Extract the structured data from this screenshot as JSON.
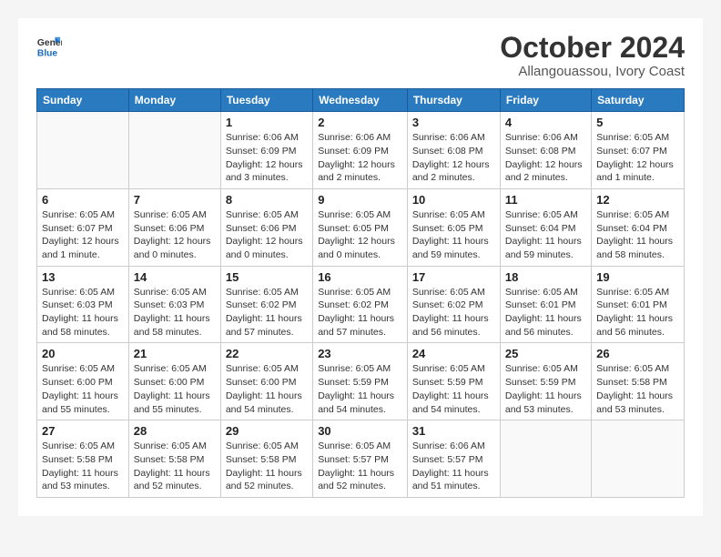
{
  "header": {
    "logo": {
      "line1": "General",
      "line2": "Blue"
    },
    "title": "October 2024",
    "location": "Allangouassou, Ivory Coast"
  },
  "weekdays": [
    "Sunday",
    "Monday",
    "Tuesday",
    "Wednesday",
    "Thursday",
    "Friday",
    "Saturday"
  ],
  "weeks": [
    [
      {
        "day": "",
        "detail": ""
      },
      {
        "day": "",
        "detail": ""
      },
      {
        "day": "1",
        "detail": "Sunrise: 6:06 AM\nSunset: 6:09 PM\nDaylight: 12 hours\nand 3 minutes."
      },
      {
        "day": "2",
        "detail": "Sunrise: 6:06 AM\nSunset: 6:09 PM\nDaylight: 12 hours\nand 2 minutes."
      },
      {
        "day": "3",
        "detail": "Sunrise: 6:06 AM\nSunset: 6:08 PM\nDaylight: 12 hours\nand 2 minutes."
      },
      {
        "day": "4",
        "detail": "Sunrise: 6:06 AM\nSunset: 6:08 PM\nDaylight: 12 hours\nand 2 minutes."
      },
      {
        "day": "5",
        "detail": "Sunrise: 6:05 AM\nSunset: 6:07 PM\nDaylight: 12 hours\nand 1 minute."
      }
    ],
    [
      {
        "day": "6",
        "detail": "Sunrise: 6:05 AM\nSunset: 6:07 PM\nDaylight: 12 hours\nand 1 minute."
      },
      {
        "day": "7",
        "detail": "Sunrise: 6:05 AM\nSunset: 6:06 PM\nDaylight: 12 hours\nand 0 minutes."
      },
      {
        "day": "8",
        "detail": "Sunrise: 6:05 AM\nSunset: 6:06 PM\nDaylight: 12 hours\nand 0 minutes."
      },
      {
        "day": "9",
        "detail": "Sunrise: 6:05 AM\nSunset: 6:05 PM\nDaylight: 12 hours\nand 0 minutes."
      },
      {
        "day": "10",
        "detail": "Sunrise: 6:05 AM\nSunset: 6:05 PM\nDaylight: 11 hours\nand 59 minutes."
      },
      {
        "day": "11",
        "detail": "Sunrise: 6:05 AM\nSunset: 6:04 PM\nDaylight: 11 hours\nand 59 minutes."
      },
      {
        "day": "12",
        "detail": "Sunrise: 6:05 AM\nSunset: 6:04 PM\nDaylight: 11 hours\nand 58 minutes."
      }
    ],
    [
      {
        "day": "13",
        "detail": "Sunrise: 6:05 AM\nSunset: 6:03 PM\nDaylight: 11 hours\nand 58 minutes."
      },
      {
        "day": "14",
        "detail": "Sunrise: 6:05 AM\nSunset: 6:03 PM\nDaylight: 11 hours\nand 58 minutes."
      },
      {
        "day": "15",
        "detail": "Sunrise: 6:05 AM\nSunset: 6:02 PM\nDaylight: 11 hours\nand 57 minutes."
      },
      {
        "day": "16",
        "detail": "Sunrise: 6:05 AM\nSunset: 6:02 PM\nDaylight: 11 hours\nand 57 minutes."
      },
      {
        "day": "17",
        "detail": "Sunrise: 6:05 AM\nSunset: 6:02 PM\nDaylight: 11 hours\nand 56 minutes."
      },
      {
        "day": "18",
        "detail": "Sunrise: 6:05 AM\nSunset: 6:01 PM\nDaylight: 11 hours\nand 56 minutes."
      },
      {
        "day": "19",
        "detail": "Sunrise: 6:05 AM\nSunset: 6:01 PM\nDaylight: 11 hours\nand 56 minutes."
      }
    ],
    [
      {
        "day": "20",
        "detail": "Sunrise: 6:05 AM\nSunset: 6:00 PM\nDaylight: 11 hours\nand 55 minutes."
      },
      {
        "day": "21",
        "detail": "Sunrise: 6:05 AM\nSunset: 6:00 PM\nDaylight: 11 hours\nand 55 minutes."
      },
      {
        "day": "22",
        "detail": "Sunrise: 6:05 AM\nSunset: 6:00 PM\nDaylight: 11 hours\nand 54 minutes."
      },
      {
        "day": "23",
        "detail": "Sunrise: 6:05 AM\nSunset: 5:59 PM\nDaylight: 11 hours\nand 54 minutes."
      },
      {
        "day": "24",
        "detail": "Sunrise: 6:05 AM\nSunset: 5:59 PM\nDaylight: 11 hours\nand 54 minutes."
      },
      {
        "day": "25",
        "detail": "Sunrise: 6:05 AM\nSunset: 5:59 PM\nDaylight: 11 hours\nand 53 minutes."
      },
      {
        "day": "26",
        "detail": "Sunrise: 6:05 AM\nSunset: 5:58 PM\nDaylight: 11 hours\nand 53 minutes."
      }
    ],
    [
      {
        "day": "27",
        "detail": "Sunrise: 6:05 AM\nSunset: 5:58 PM\nDaylight: 11 hours\nand 53 minutes."
      },
      {
        "day": "28",
        "detail": "Sunrise: 6:05 AM\nSunset: 5:58 PM\nDaylight: 11 hours\nand 52 minutes."
      },
      {
        "day": "29",
        "detail": "Sunrise: 6:05 AM\nSunset: 5:58 PM\nDaylight: 11 hours\nand 52 minutes."
      },
      {
        "day": "30",
        "detail": "Sunrise: 6:05 AM\nSunset: 5:57 PM\nDaylight: 11 hours\nand 52 minutes."
      },
      {
        "day": "31",
        "detail": "Sunrise: 6:06 AM\nSunset: 5:57 PM\nDaylight: 11 hours\nand 51 minutes."
      },
      {
        "day": "",
        "detail": ""
      },
      {
        "day": "",
        "detail": ""
      }
    ]
  ]
}
